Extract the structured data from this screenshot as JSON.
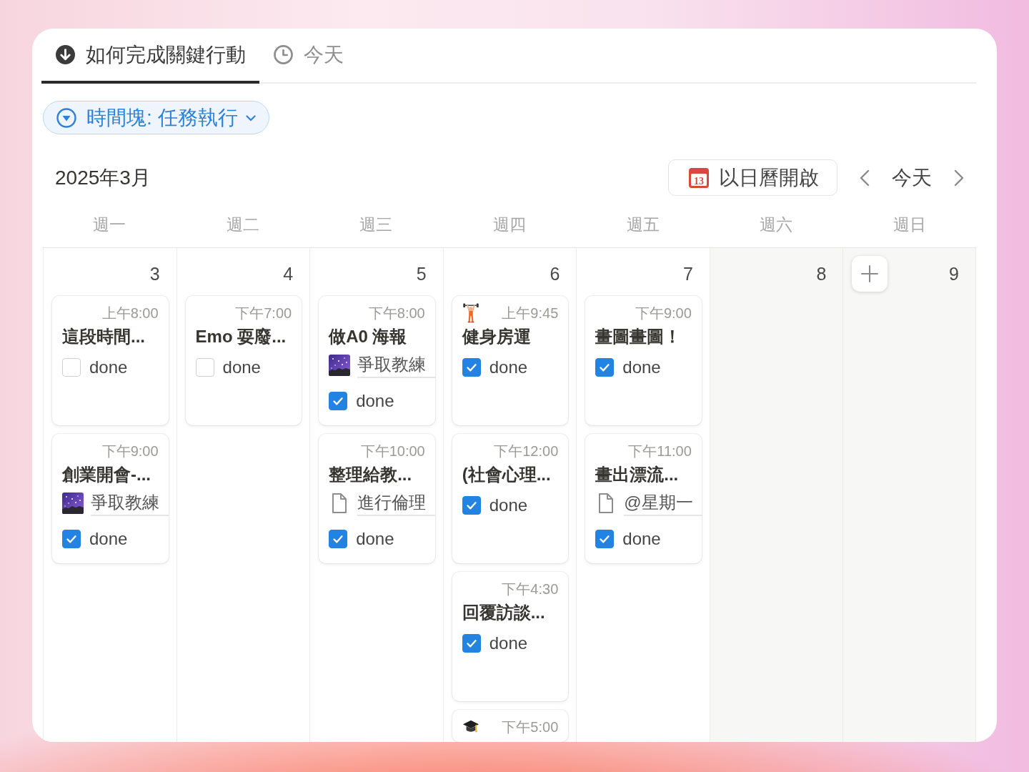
{
  "tabs": [
    {
      "label": "如何完成關鍵行動",
      "selected": true
    },
    {
      "label": "今天",
      "selected": false
    }
  ],
  "filter": {
    "label": "時間塊: 任務執行"
  },
  "toolbar": {
    "month": "2025年3月",
    "open_button": {
      "label": "以日曆開啟",
      "icon_day": "13"
    },
    "today_button": "今天"
  },
  "weekdays": [
    "週一",
    "週二",
    "週三",
    "週四",
    "週五",
    "週六",
    "週日"
  ],
  "days": [
    {
      "date": "3",
      "weekend": false,
      "hovered": false,
      "events": [
        {
          "kind": "plain",
          "title": "這段時間...",
          "time": "上午8:00",
          "done": {
            "label": "done",
            "checked": false
          }
        },
        {
          "kind": "plain",
          "title": "創業開會-...",
          "time": "下午9:00",
          "relation": {
            "kind": "image",
            "text": "爭取教練"
          },
          "done": {
            "label": "done",
            "checked": true
          }
        }
      ]
    },
    {
      "date": "4",
      "weekend": false,
      "hovered": false,
      "events": [
        {
          "kind": "plain",
          "title": "Emo 耍廢...",
          "time": "下午7:00",
          "done": {
            "label": "done",
            "checked": false
          }
        }
      ]
    },
    {
      "date": "5",
      "weekend": false,
      "hovered": false,
      "events": [
        {
          "kind": "plain",
          "title": "做A0 海報",
          "time": "下午8:00",
          "relation": {
            "kind": "image",
            "text": "爭取教練"
          },
          "done": {
            "label": "done",
            "checked": true
          }
        },
        {
          "kind": "plain",
          "title": "整理給教...",
          "time": "下午10:00",
          "relation": {
            "kind": "page",
            "text": "進行倫理"
          },
          "done": {
            "label": "done",
            "checked": true
          }
        }
      ]
    },
    {
      "date": "6",
      "weekend": false,
      "hovered": false,
      "events": [
        {
          "kind": "gym",
          "title": "健身房運",
          "time": "上午9:45",
          "done": {
            "label": "done",
            "checked": true
          }
        },
        {
          "kind": "plain",
          "title": "(社會心理...",
          "time": "下午12:00",
          "done": {
            "label": "done",
            "checked": true
          }
        },
        {
          "kind": "plain",
          "title": "回覆訪談...",
          "time": "下午4:30",
          "done": {
            "label": "done",
            "checked": true
          }
        },
        {
          "kind": "study",
          "time": "下午5:00"
        }
      ]
    },
    {
      "date": "7",
      "weekend": false,
      "hovered": false,
      "events": [
        {
          "kind": "plain",
          "title": "畫圖畫圖！",
          "time": "下午9:00",
          "done": {
            "label": "done",
            "checked": true
          }
        },
        {
          "kind": "plain",
          "title": "畫出漂流...",
          "time": "下午11:00",
          "relation": {
            "kind": "page",
            "text": "@星期一"
          },
          "done": {
            "label": "done",
            "checked": true
          }
        }
      ]
    },
    {
      "date": "8",
      "weekend": true,
      "hovered": false
    },
    {
      "date": "9",
      "weekend": true,
      "hovered": true
    }
  ]
}
